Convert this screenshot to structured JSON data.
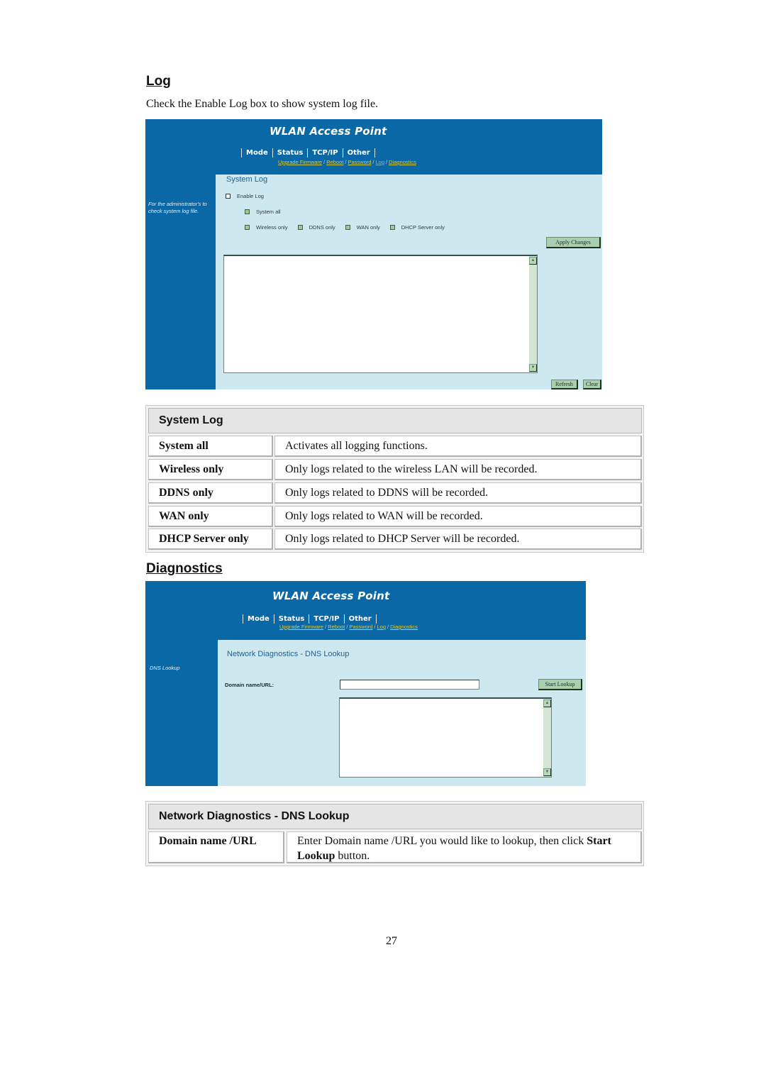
{
  "log_section": {
    "heading": "Log",
    "intro": "Check the Enable Log box to show system log file."
  },
  "log_screenshot": {
    "brand": "WLAN Access Point",
    "tabs": [
      "Mode",
      "Status",
      "TCP/IP",
      "Other"
    ],
    "sublinks": [
      {
        "label": "Upgrade Firmware",
        "active": false
      },
      {
        "label": "Reboot",
        "active": false
      },
      {
        "label": "Password",
        "active": false
      },
      {
        "label": "Log",
        "active": true
      },
      {
        "label": "Diagnostics",
        "active": false
      }
    ],
    "sublink_separator": "/",
    "side_note": "For the administrator's to check system log file.",
    "panel_title": "System Log",
    "enable_log": {
      "label": "Enable Log",
      "checked": false
    },
    "system_all": {
      "label": "System all",
      "checked": false
    },
    "filters": [
      {
        "label": "Wireless only",
        "checked": false
      },
      {
        "label": "DDNS only",
        "checked": false
      },
      {
        "label": "WAN only",
        "checked": false
      },
      {
        "label": "DHCP Server only",
        "checked": false
      }
    ],
    "apply_button": "Apply Changes",
    "log_text": "",
    "refresh_button": "Refresh",
    "clear_button": "Clear",
    "scroll_up_icon": "▲",
    "scroll_down_icon": "▼"
  },
  "system_log_table": {
    "title": "System Log",
    "rows": [
      {
        "term": "System all",
        "desc": "Activates all logging functions."
      },
      {
        "term": "Wireless only",
        "desc": "Only logs related to the wireless LAN will be recorded."
      },
      {
        "term": "DDNS only",
        "desc": "Only logs related to DDNS will be recorded."
      },
      {
        "term": "WAN only",
        "desc": "Only logs related to WAN will be recorded."
      },
      {
        "term": "DHCP Server only",
        "desc": "Only logs related to DHCP Server will be recorded."
      }
    ]
  },
  "diag_section": {
    "heading": "Diagnostics"
  },
  "diag_screenshot": {
    "brand": "WLAN Access Point",
    "tabs": [
      "Mode",
      "Status",
      "TCP/IP",
      "Other"
    ],
    "sublinks": [
      {
        "label": "Upgrade Firmware",
        "active": false
      },
      {
        "label": "Reboot",
        "active": false
      },
      {
        "label": "Password",
        "active": false
      },
      {
        "label": "Log",
        "active": false
      },
      {
        "label": "Diagnostics",
        "active": false
      }
    ],
    "sublink_separator": "/",
    "side_note": "DNS Lookup",
    "panel_title": "Network Diagnostics - DNS Lookup",
    "domain_label": "Domain name/URL:",
    "domain_value": "",
    "start_button": "Start Lookup",
    "result_text": "",
    "scroll_up_icon": "▲",
    "scroll_down_icon": "▼"
  },
  "dns_table": {
    "title": "Network Diagnostics - DNS Lookup",
    "term": "Domain name /URL",
    "desc_pre": "Enter Domain name /URL you would like to lookup, then click ",
    "desc_bold": "Start Lookup",
    "desc_post": " button."
  },
  "page_number": "27",
  "colors": {
    "header_blue": "#0b68a6",
    "panel_bg": "#cde8ee",
    "link_yellow": "#d4c94a",
    "button_green": "#a9d0ae"
  }
}
